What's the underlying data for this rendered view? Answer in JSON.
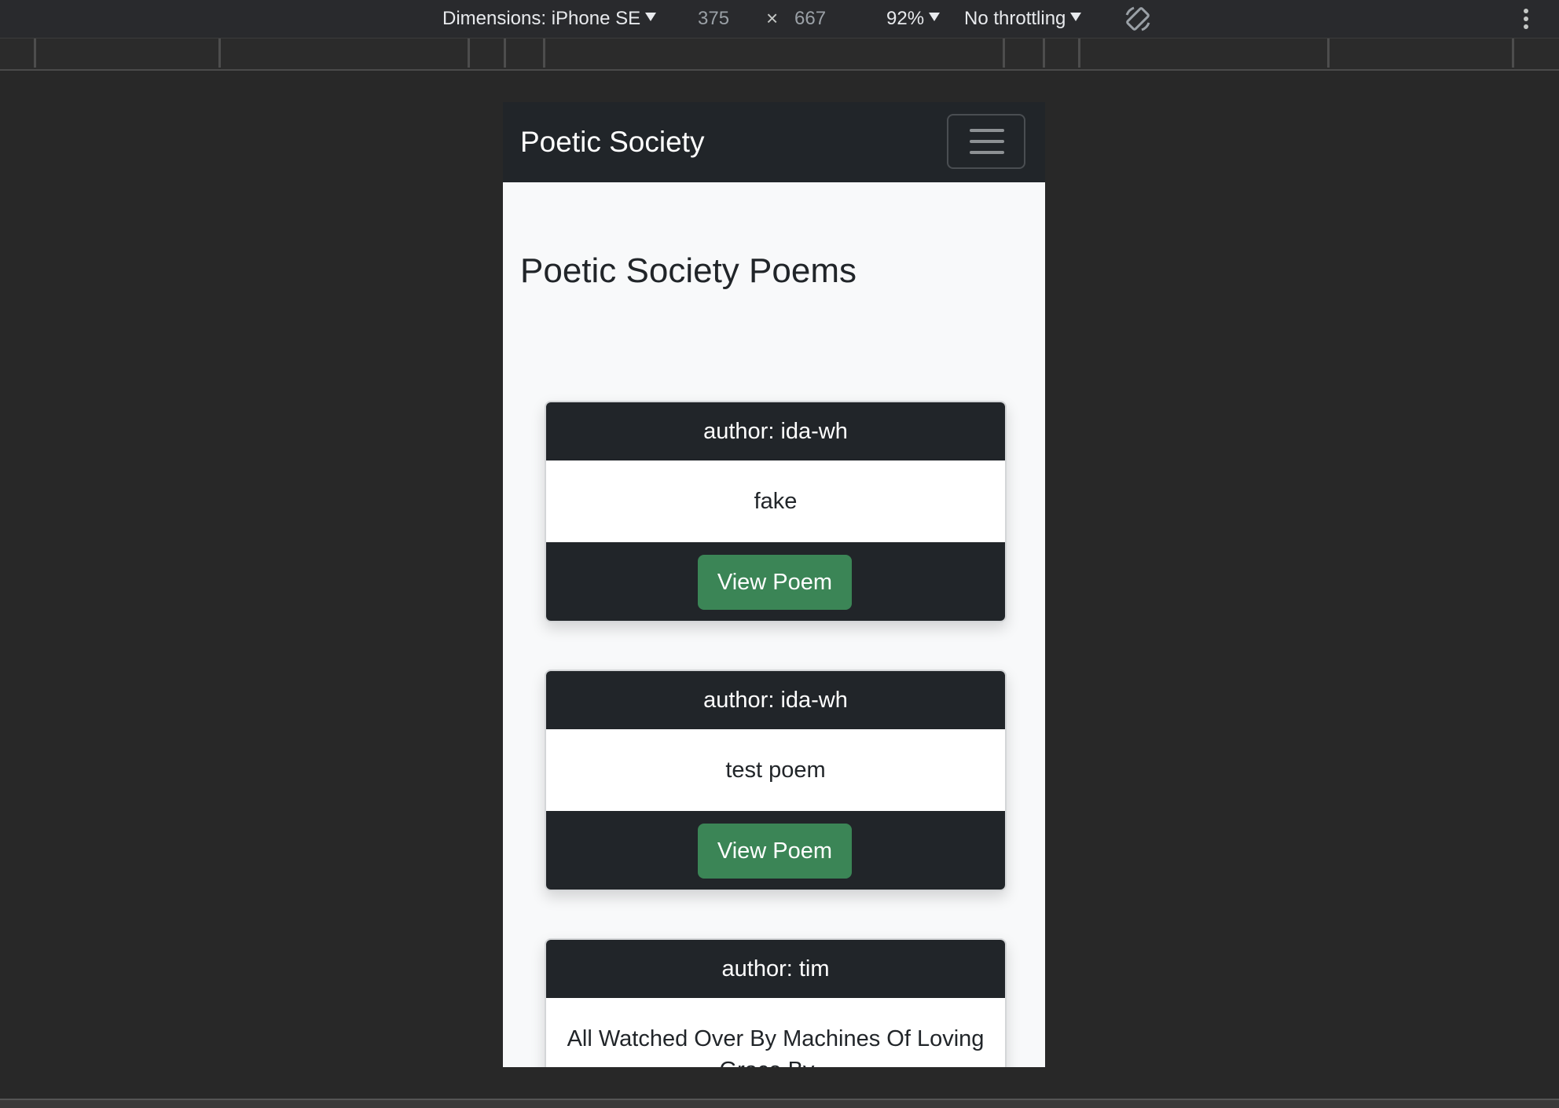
{
  "devtools": {
    "dimensions_label": "Dimensions: iPhone SE",
    "width": "375",
    "times": "×",
    "height": "667",
    "zoom": "92%",
    "throttling": "No throttling"
  },
  "navbar": {
    "brand": "Poetic Society"
  },
  "page": {
    "title": "Poetic Society Poems"
  },
  "poems": [
    {
      "author": "author: ida-wh",
      "title": "fake",
      "button": "View Poem"
    },
    {
      "author": "author: ida-wh",
      "title": "test poem",
      "button": "View Poem"
    },
    {
      "author": "author: tim",
      "title": "All Watched Over By Machines Of Loving Grace By..."
    }
  ],
  "colors": {
    "navbar_bg": "#212529",
    "button_bg": "#3b8556",
    "page_bg": "#f8f9fa"
  }
}
